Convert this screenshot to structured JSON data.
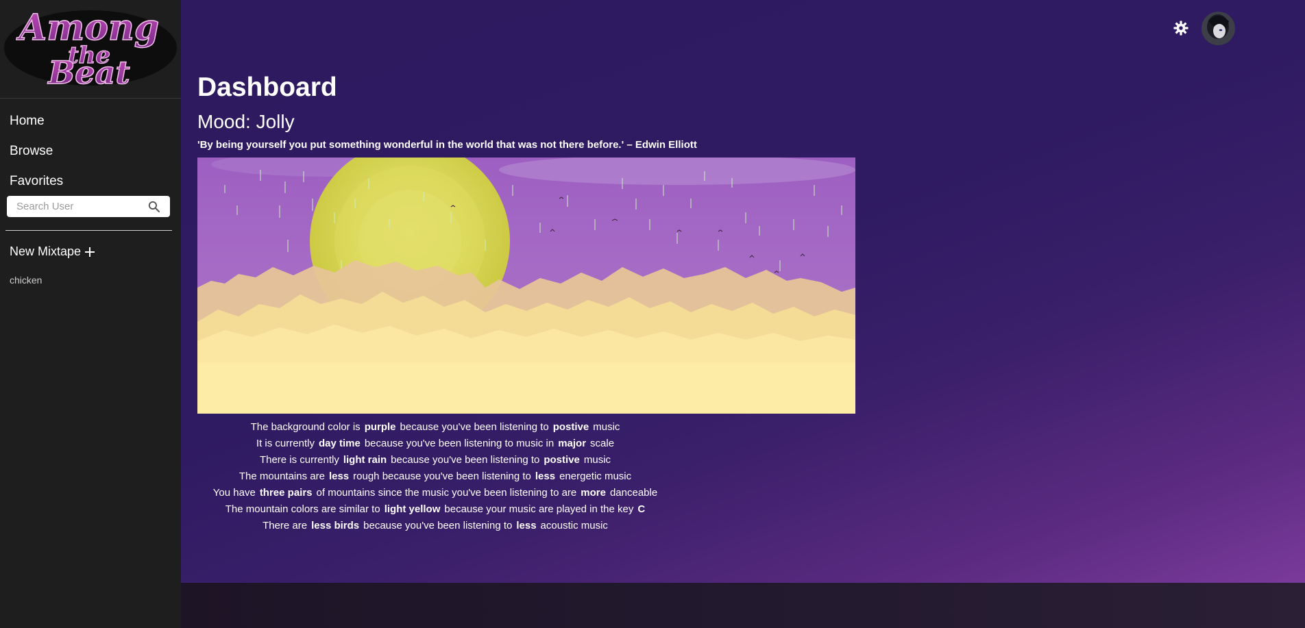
{
  "app": {
    "logo_text": [
      "Among",
      "the",
      "Beat"
    ]
  },
  "sidebar": {
    "nav": [
      {
        "label": "Home"
      },
      {
        "label": "Browse"
      },
      {
        "label": "Favorites"
      }
    ],
    "search": {
      "placeholder": "Search User",
      "value": ""
    },
    "new_mixtape_label": "New Mixtape",
    "mixtapes": [
      "chicken"
    ]
  },
  "header": {
    "settings_icon": "gear-icon",
    "avatar_icon": "user-avatar"
  },
  "main": {
    "title": "Dashboard",
    "mood": "Mood: Jolly",
    "quote": "'By being yourself you put something wonderful in the world that was not there before.' – Edwin Elliott",
    "explanations": [
      {
        "pre": "The background color is",
        "b1": "purple",
        "mid": "because you've been listening to",
        "b2": "postive",
        "post": "music"
      },
      {
        "pre": "It is currently",
        "b1": "day time",
        "mid": "because you've been listening to music in",
        "b2": "major",
        "post": "scale"
      },
      {
        "pre": "There is currently",
        "b1": "light rain",
        "mid": "because you've been listening to",
        "b2": "postive",
        "post": "music"
      },
      {
        "pre": "The mountains are",
        "b1": "less",
        "mid": "rough because you've been listening to",
        "b2": "less",
        "post": "energetic music"
      },
      {
        "pre": "You have",
        "b1": "three pairs",
        "mid": "of mountains since the music you've been listening to are",
        "b2": "more",
        "post": "danceable"
      },
      {
        "pre": "The mountain colors are similar to",
        "b1": "light yellow",
        "mid": "because your music are played in the key",
        "b2": "C",
        "post": ""
      },
      {
        "pre": "There are",
        "b1": "less birds",
        "mid": "because you've been listening to",
        "b2": "less",
        "post": "acoustic music"
      }
    ]
  },
  "colors": {
    "sidebar_bg": "#1e1e1e",
    "main_bg": "#2e1a5e",
    "sky": "#a66fc4",
    "sun": "#d6d84a",
    "mountains": "#fbeaa0"
  }
}
